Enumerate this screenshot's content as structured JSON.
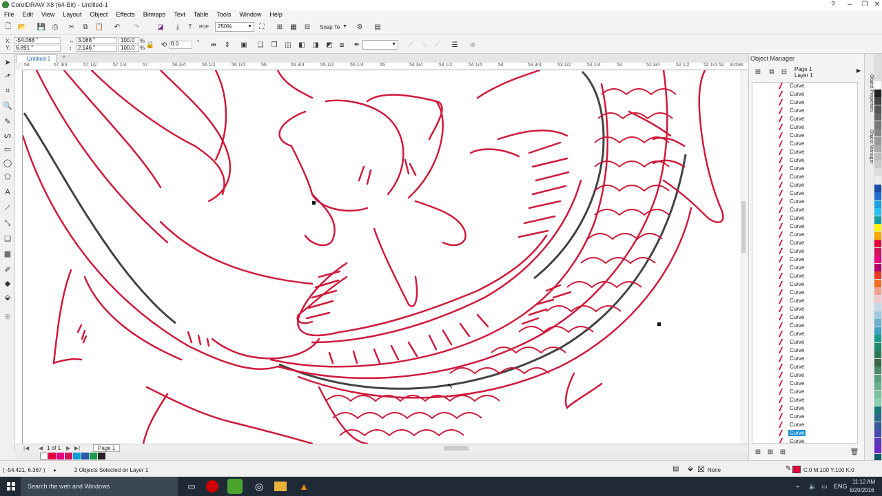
{
  "window": {
    "title": "CorelDRAW X8 (64-Bit) - Untitled-1"
  },
  "menu": [
    "File",
    "Edit",
    "View",
    "Layout",
    "Object",
    "Effects",
    "Bitmaps",
    "Text",
    "Table",
    "Tools",
    "Window",
    "Help"
  ],
  "toolbar": {
    "zoom": "250%",
    "snap_to": "Snap To"
  },
  "props": {
    "x": "-54.068 \"",
    "y": "6.891 \"",
    "w": "3.088 \"",
    "h": "2.146 \"",
    "sx": "100.0",
    "sy": "100.0",
    "pct": "%",
    "angle": "0.0",
    "deg": "°"
  },
  "doc": {
    "tab": "Untitled-1"
  },
  "ruler": {
    "labels": [
      "58",
      "57 3/4",
      "57 1/2",
      "57 1/4",
      "57",
      "56 3/4",
      "56 1/2",
      "56 1/4",
      "56",
      "55 3/4",
      "55 1/2",
      "55 1/4",
      "55",
      "54 3/4",
      "54 1/2",
      "54 1/4",
      "54",
      "53 3/4",
      "53 1/2",
      "53 1/4",
      "53",
      "52 3/4",
      "52 1/2",
      "52 1/4",
      "52"
    ],
    "unit": "inches"
  },
  "pages": {
    "counter": "1 of 1",
    "tab": "Page 1"
  },
  "status": {
    "cursor": "( -54.421, 6.367 )",
    "selection": "2 Objects Selected on Layer 1",
    "fill_none": "None",
    "outline": "C:0 M:100 Y:100 K:0"
  },
  "docker": {
    "title": "Object Manager",
    "page": "Page 1",
    "layer": "Layer 1",
    "item_label": "Curve",
    "side_tabs": [
      "Object Properties",
      "Object Manager"
    ]
  },
  "taskbar": {
    "search": "Search the web and Windows",
    "lang": "ENG",
    "time": "11:12 AM",
    "date": "8/20/2016"
  },
  "colors": {
    "accent": "#1e8fd6",
    "stroke": "#d01a3b",
    "bg": "#f0f0f0"
  }
}
